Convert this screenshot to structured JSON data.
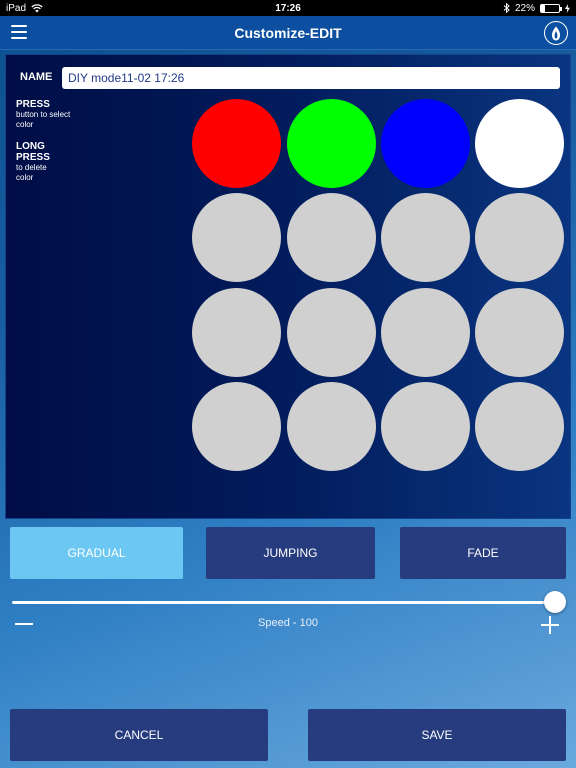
{
  "status_bar": {
    "device": "iPad",
    "time": "17:26",
    "battery": "22%",
    "battery_level": 0.22
  },
  "nav": {
    "title": "Customize-EDIT",
    "menu_icon": "hamburger-menu-icon",
    "brand_icon": "flame-logo-icon"
  },
  "editor": {
    "name_label": "NAME",
    "name_value": "DIY mode11-02 17:26",
    "press_title": "PRESS",
    "press_text": "button to select color",
    "long_press_title": "LONG PRESS",
    "long_press_text": "to delete color",
    "colors": [
      "#ff0000",
      "#00ff00",
      "#0000ff",
      "#ffffff",
      "#d0d0d0",
      "#d0d0d0",
      "#d0d0d0",
      "#d0d0d0",
      "#d0d0d0",
      "#d0d0d0",
      "#d0d0d0",
      "#d0d0d0",
      "#d0d0d0",
      "#d0d0d0",
      "#d0d0d0",
      "#d0d0d0"
    ]
  },
  "modes": {
    "gradual": "GRADUAL",
    "jumping": "JUMPING",
    "fade": "FADE",
    "selected": "GRADUAL"
  },
  "speed": {
    "label": "Speed - 100",
    "value": 100,
    "max": 100
  },
  "actions": {
    "cancel": "CANCEL",
    "save": "SAVE"
  },
  "theme": {
    "active_mode_color": "#6cc8f2",
    "button_color": "#273c7e"
  }
}
